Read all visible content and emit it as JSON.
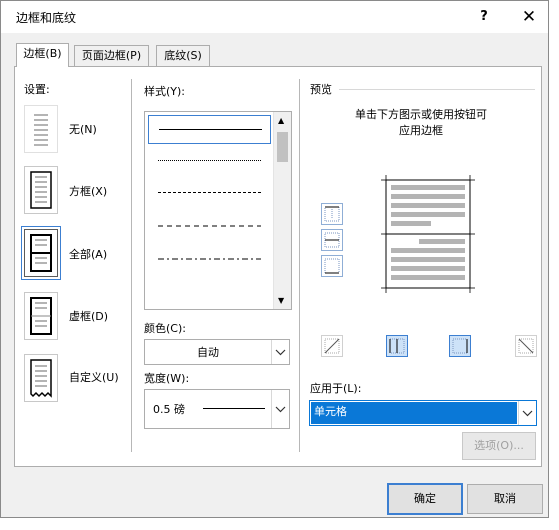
{
  "dialog": {
    "title": "边框和底纹",
    "help_label": "?",
    "close_label": "✕",
    "tabs": [
      {
        "label": "边框(B)",
        "active": true
      },
      {
        "label": "页面边框(P)",
        "active": false
      },
      {
        "label": "底纹(S)",
        "active": false
      }
    ]
  },
  "settings": {
    "heading": "设置:",
    "items": [
      {
        "label": "无(N)",
        "icon": "setting-none-icon"
      },
      {
        "label": "方框(X)",
        "icon": "setting-box-icon"
      },
      {
        "label": "全部(A)",
        "icon": "setting-all-icon",
        "selected": true
      },
      {
        "label": "虚框(D)",
        "icon": "setting-grid-icon"
      },
      {
        "label": "自定义(U)",
        "icon": "setting-custom-icon"
      }
    ]
  },
  "style": {
    "heading": "样式(Y):",
    "options": [
      "solid",
      "dotted",
      "dashed-small",
      "dashed",
      "dash-dot"
    ],
    "selected_index": 0
  },
  "color": {
    "label": "颜色(C):",
    "value": "自动"
  },
  "width": {
    "label": "宽度(W):",
    "value": "0.5 磅"
  },
  "preview": {
    "heading": "预览",
    "instructions_line1": "单击下方图示或使用按钮可",
    "instructions_line2": "应用边框"
  },
  "apply_to": {
    "label": "应用于(L):",
    "value": "单元格"
  },
  "buttons": {
    "options": "选项(O)...",
    "ok": "确定",
    "cancel": "取消"
  },
  "colors": {
    "accent": "#3c7fd1",
    "selection": "#0a78d7"
  }
}
